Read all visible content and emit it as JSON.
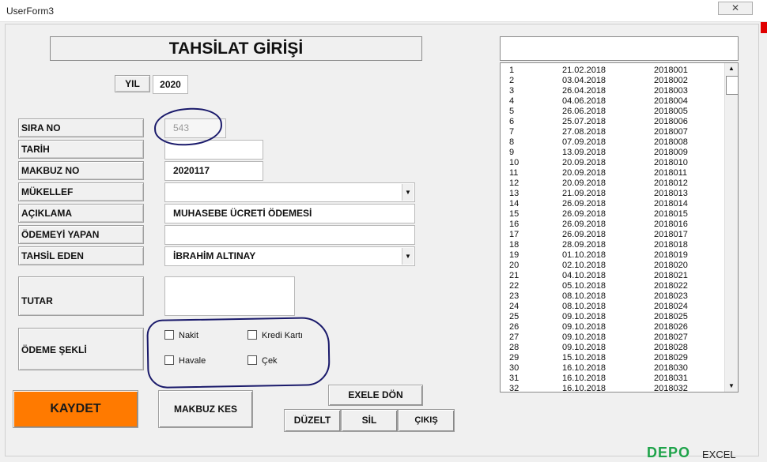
{
  "window": {
    "title": "UserForm3",
    "close_glyph": "✕"
  },
  "header": {
    "title": "TAHSİLAT GİRİŞİ"
  },
  "year": {
    "label": "YIL",
    "value": "2020"
  },
  "fields": {
    "sira_no": {
      "label": "SIRA NO",
      "value": "543"
    },
    "tarih": {
      "label": "TARİH",
      "value": ""
    },
    "makbuz_no": {
      "label": "MAKBUZ NO",
      "value": "2020117"
    },
    "mukellef": {
      "label": "MÜKELLEF",
      "value": ""
    },
    "aciklama": {
      "label": "AÇIKLAMA",
      "value": "MUHASEBE ÜCRETİ ÖDEMESİ"
    },
    "odemeyi_yapan": {
      "label": "ÖDEMEYİ YAPAN",
      "value": ""
    },
    "tahsil_eden": {
      "label": "TAHSİL EDEN",
      "value": "İBRAHİM ALTINAY"
    },
    "tutar": {
      "label": "TUTAR",
      "value": ""
    }
  },
  "odeme_sekli": {
    "label": "ÖDEME ŞEKLİ",
    "options": [
      "Nakit",
      "Kredi Kartı",
      "Havale",
      "Çek"
    ]
  },
  "buttons": {
    "kaydet": "KAYDET",
    "makbuz_kes": "MAKBUZ KES",
    "exele_don": "EXELE DÖN",
    "duzelt": "DÜZELT",
    "sil": "SİL",
    "cikis": "ÇIKIŞ"
  },
  "list": {
    "rows": [
      [
        "1",
        "21.02.2018",
        "2018001"
      ],
      [
        "2",
        "03.04.2018",
        "2018002"
      ],
      [
        "3",
        "26.04.2018",
        "2018003"
      ],
      [
        "4",
        "04.06.2018",
        "2018004"
      ],
      [
        "5",
        "26.06.2018",
        "2018005"
      ],
      [
        "6",
        "25.07.2018",
        "2018006"
      ],
      [
        "7",
        "27.08.2018",
        "2018007"
      ],
      [
        "8",
        "07.09.2018",
        "2018008"
      ],
      [
        "9",
        "13.09.2018",
        "2018009"
      ],
      [
        "10",
        "20.09.2018",
        "2018010"
      ],
      [
        "11",
        "20.09.2018",
        "2018011"
      ],
      [
        "12",
        "20.09.2018",
        "2018012"
      ],
      [
        "13",
        "21.09.2018",
        "2018013"
      ],
      [
        "14",
        "26.09.2018",
        "2018014"
      ],
      [
        "15",
        "26.09.2018",
        "2018015"
      ],
      [
        "16",
        "26.09.2018",
        "2018016"
      ],
      [
        "17",
        "26.09.2018",
        "2018017"
      ],
      [
        "18",
        "28.09.2018",
        "2018018"
      ],
      [
        "19",
        "01.10.2018",
        "2018019"
      ],
      [
        "20",
        "02.10.2018",
        "2018020"
      ],
      [
        "21",
        "04.10.2018",
        "2018021"
      ],
      [
        "22",
        "05.10.2018",
        "2018022"
      ],
      [
        "23",
        "08.10.2018",
        "2018023"
      ],
      [
        "24",
        "08.10.2018",
        "2018024"
      ],
      [
        "25",
        "09.10.2018",
        "2018025"
      ],
      [
        "26",
        "09.10.2018",
        "2018026"
      ],
      [
        "27",
        "09.10.2018",
        "2018027"
      ],
      [
        "28",
        "09.10.2018",
        "2018028"
      ],
      [
        "29",
        "15.10.2018",
        "2018029"
      ],
      [
        "30",
        "16.10.2018",
        "2018030"
      ],
      [
        "31",
        "16.10.2018",
        "2018031"
      ],
      [
        "32",
        "16.10.2018",
        "2018032"
      ]
    ]
  },
  "colors": {
    "kaydet_bg": "#ff7a00",
    "annotation": "#1a1a6b"
  },
  "watermark": {
    "text1": "DEPO",
    "text2": "EXCEL"
  }
}
